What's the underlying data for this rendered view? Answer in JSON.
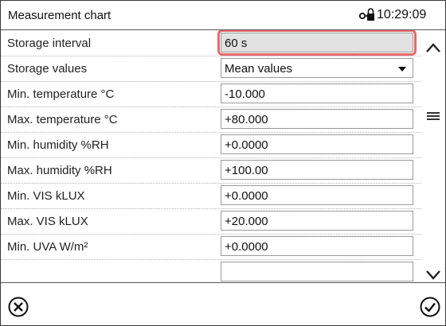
{
  "header": {
    "title": "Measurement chart",
    "lock_icon": "lock-key-icon",
    "time": "10:29:09"
  },
  "rows": [
    {
      "label": "Storage interval",
      "value": "60 s",
      "selected": true
    },
    {
      "label": "Storage values",
      "value": "Mean values",
      "type": "select"
    },
    {
      "label": "Min. temperature °C",
      "value": "-10.000"
    },
    {
      "label": "Max. temperature °C",
      "value": "+80.000"
    },
    {
      "label": "Min. humidity %RH",
      "value": "+0.0000"
    },
    {
      "label": "Max. humidity %RH",
      "value": "+100.00"
    },
    {
      "label": "Min. VIS kLUX",
      "value": "+0.0000"
    },
    {
      "label": "Max. VIS kLUX",
      "value": "+20.000"
    },
    {
      "label": "Min. UVA W/m²",
      "value": "+0.0000"
    }
  ],
  "scrollbar": {
    "up_icon": "chevron-up-icon",
    "menu_icon": "hamburger-menu-icon",
    "down_icon": "chevron-down-icon"
  },
  "footer": {
    "cancel_icon": "cancel-circle-icon",
    "confirm_icon": "confirm-check-icon"
  },
  "colors": {
    "selection_outline": "#e8696b",
    "selected_field_bg": "#e2e2e2"
  }
}
